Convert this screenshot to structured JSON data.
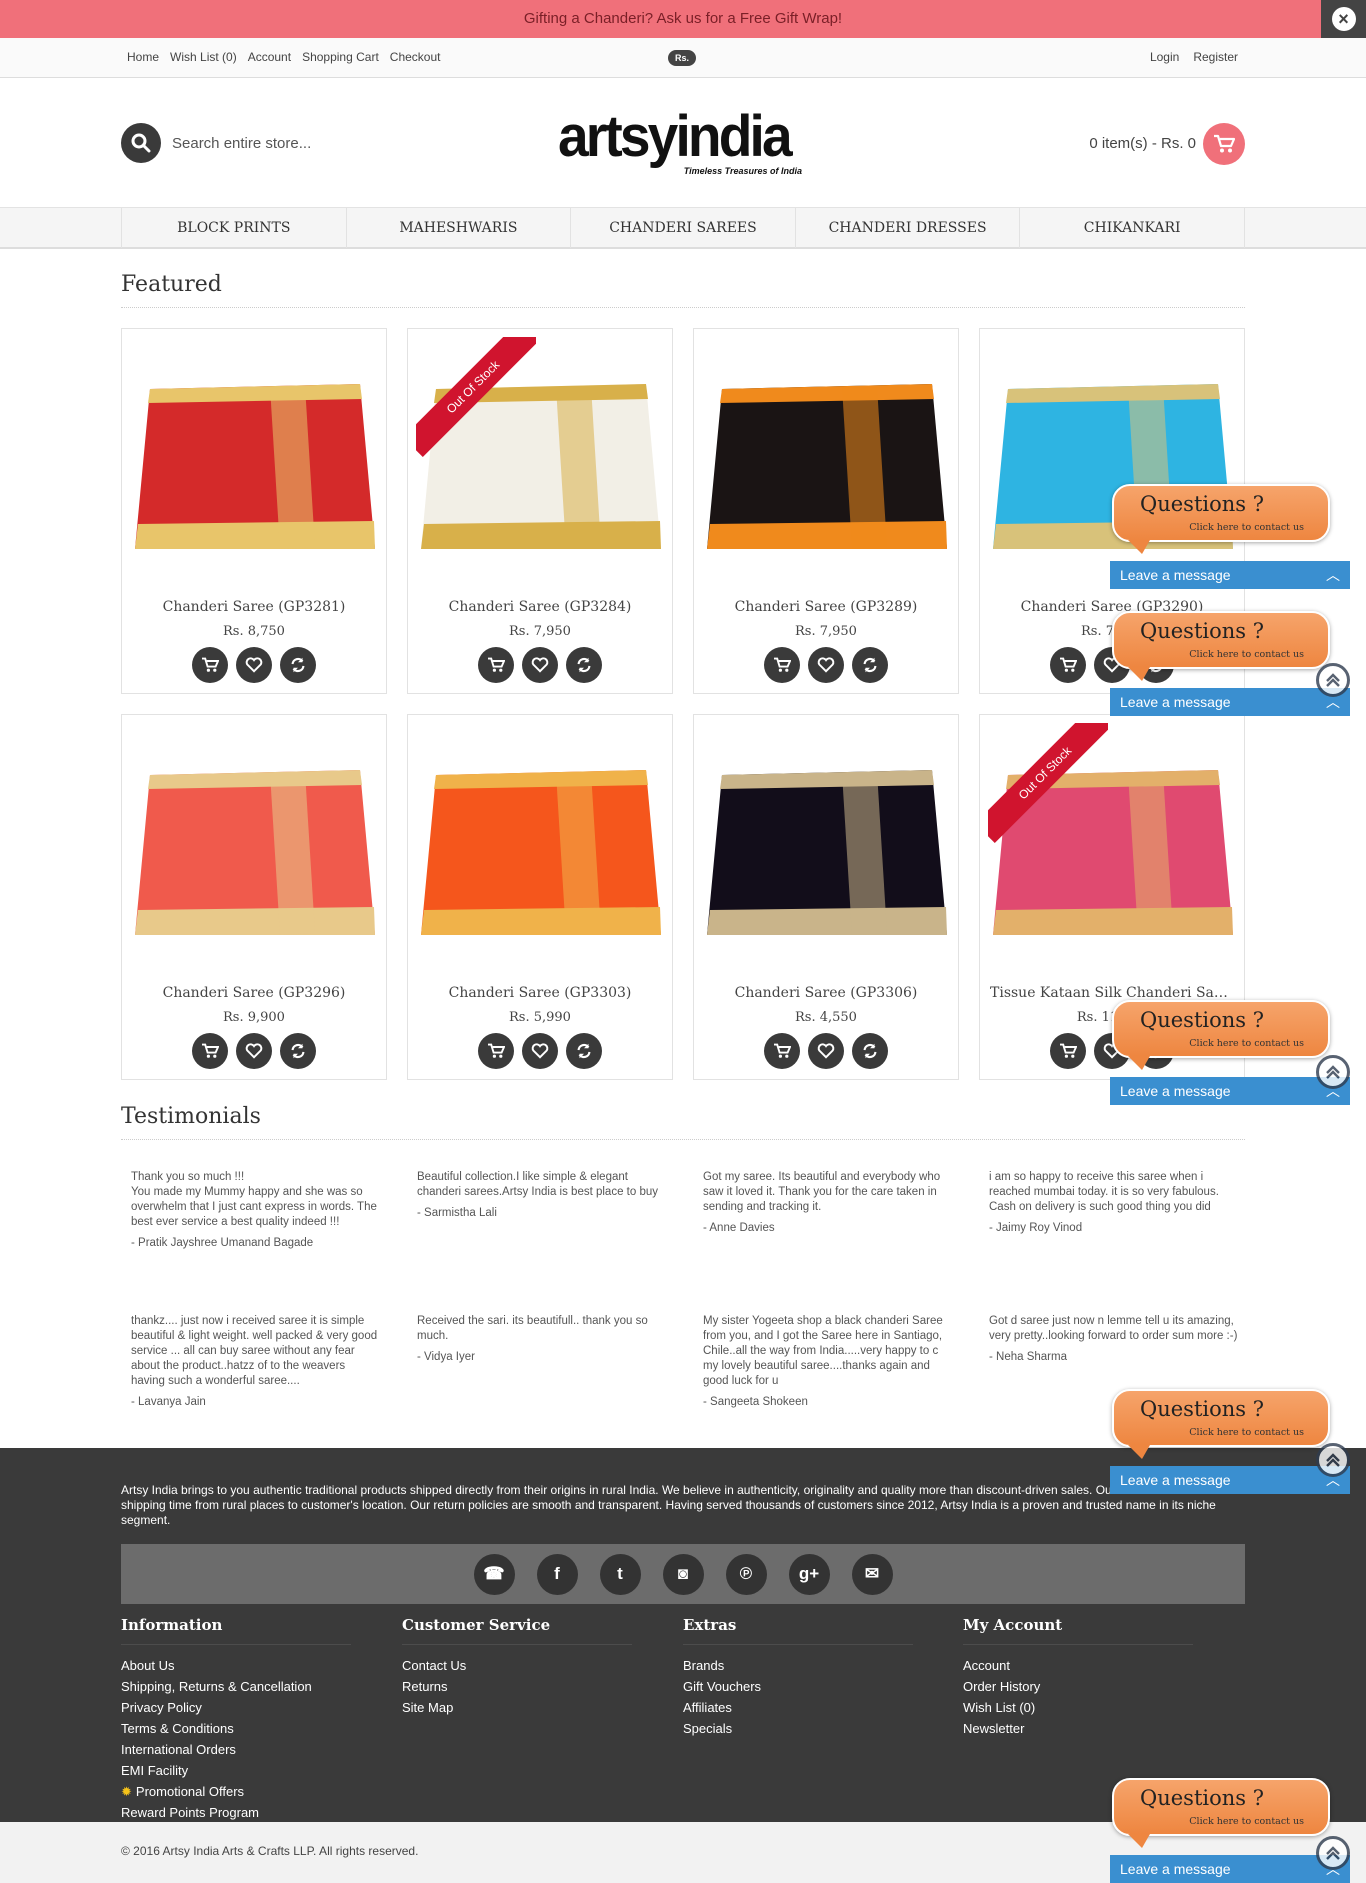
{
  "promo": {
    "text": "Gifting a Chanderi? Ask us for a Free Gift Wrap!",
    "close_icon": "close-icon"
  },
  "toplinks": {
    "left": [
      "Home",
      "Wish List (0)",
      "Account",
      "Shopping Cart",
      "Checkout"
    ],
    "currency": "Rs.",
    "right": [
      "Login",
      "Register"
    ]
  },
  "header": {
    "search_placeholder": "Search entire store...",
    "logo_main": "artsyindia",
    "logo_tagline": "Timeless Treasures of India",
    "cart_text": "0 item(s) - Rs. 0"
  },
  "nav": [
    "BLOCK PRINTS",
    "MAHESHWARIS",
    "CHANDERI SAREES",
    "CHANDERI DRESSES",
    "CHIKANKARI"
  ],
  "featured": {
    "title": "Featured",
    "out_of_stock_label": "Out Of Stock",
    "products": [
      {
        "name": "Chanderi Saree (GP3281)",
        "price": "Rs. 8,750",
        "out_of_stock": false,
        "colors": [
          "#d42a2a",
          "#e8c56a"
        ]
      },
      {
        "name": "Chanderi Saree (GP3284)",
        "price": "Rs. 7,950",
        "out_of_stock": true,
        "colors": [
          "#f2efe6",
          "#d8b04a"
        ]
      },
      {
        "name": "Chanderi Saree (GP3289)",
        "price": "Rs. 7,950",
        "out_of_stock": false,
        "colors": [
          "#1a1414",
          "#f08a1c"
        ]
      },
      {
        "name": "Chanderi Saree (GP3290)",
        "price": "Rs. 7,950",
        "out_of_stock": false,
        "colors": [
          "#2eb4e2",
          "#d8c27a"
        ]
      },
      {
        "name": "Chanderi Saree (GP3296)",
        "price": "Rs. 9,900",
        "out_of_stock": false,
        "colors": [
          "#f05a4c",
          "#e8c98a"
        ]
      },
      {
        "name": "Chanderi Saree (GP3303)",
        "price": "Rs. 5,990",
        "out_of_stock": false,
        "colors": [
          "#f5561c",
          "#f0b24a"
        ]
      },
      {
        "name": "Chanderi Saree (GP3306)",
        "price": "Rs. 4,550",
        "out_of_stock": false,
        "colors": [
          "#120d1a",
          "#c9b48a"
        ]
      },
      {
        "name": "Tissue Kataan Silk Chanderi Saree...",
        "price": "Rs. 11,500",
        "out_of_stock": true,
        "colors": [
          "#e04a70",
          "#e3b06a"
        ]
      }
    ],
    "action_icons": [
      "cart-icon",
      "heart-icon",
      "compare-icon"
    ]
  },
  "testimonials": {
    "title": "Testimonials",
    "items": [
      {
        "text": "Thank you so much !!!\nYou made my Mummy happy and she was so overwhelm that I just cant express in words. The best ever service a best quality indeed !!!",
        "author": "- Pratik Jayshree Umanand Bagade"
      },
      {
        "text": "Beautiful collection.I like simple & elegant chanderi sarees.Artsy India is best place to buy",
        "author": "- Sarmistha Lali"
      },
      {
        "text": "Got my saree. Its beautiful and everybody who saw it loved it. Thank you for the care taken in sending and tracking it.",
        "author": "- Anne Davies"
      },
      {
        "text": "i am so happy to receive this saree when i reached mumbai today. it is so very fabulous. Cash on delivery is such good thing you did",
        "author": "- Jaimy Roy Vinod"
      },
      {
        "text": "thankz.... just now i received saree it is simple beautiful & light weight. well packed & very good service ... all can buy saree without any fear about the product..hatzz of to the weavers having such a wonderful saree....",
        "author": "- Lavanya Jain"
      },
      {
        "text": "Received the sari. its beautifull.. thank you so much.",
        "author": "- Vidya Iyer"
      },
      {
        "text": "My sister Yogeeta shop a black chanderi Saree from you, and I got the Saree here in Santiago, Chile..all the way from India.....very happy to c my lovely beautiful saree....thanks again and good luck for u",
        "author": "- Sangeeta Shokeen"
      },
      {
        "text": "Got d saree just now n lemme tell u its amazing, very pretty..looking forward to order sum more :-)",
        "author": "- Neha Sharma"
      }
    ]
  },
  "footer": {
    "about": "Artsy India brings to you authentic traditional products shipped directly from their origins in rural India. We believe in authenticity, originality and quality more than discount-driven sales. Our endeavour is to reduce shipping time from rural places to customer's location. Our return policies are smooth and transparent. Having served thousands of customers since 2012, Artsy India is a proven and trusted name in its niche segment.",
    "social": [
      {
        "icon": "phone-icon",
        "glyph": "☎"
      },
      {
        "icon": "facebook-icon",
        "glyph": "f"
      },
      {
        "icon": "tumblr-icon",
        "glyph": "t"
      },
      {
        "icon": "instagram-icon",
        "glyph": "◙"
      },
      {
        "icon": "pinterest-icon",
        "glyph": "℗"
      },
      {
        "icon": "google-plus-icon",
        "glyph": "g+"
      },
      {
        "icon": "email-icon",
        "glyph": "✉"
      }
    ],
    "columns": [
      {
        "title": "Information",
        "links": [
          "About Us",
          "Shipping, Returns & Cancellation",
          "Privacy Policy",
          "Terms & Conditions",
          "International Orders",
          "EMI Facility",
          "Promotional Offers",
          "Reward Points Program"
        ]
      },
      {
        "title": "Customer Service",
        "links": [
          "Contact Us",
          "Returns",
          "Site Map"
        ]
      },
      {
        "title": "Extras",
        "links": [
          "Brands",
          "Gift Vouchers",
          "Affiliates",
          "Specials"
        ]
      },
      {
        "title": "My Account",
        "links": [
          "Account",
          "Order History",
          "Wish List (0)",
          "Newsletter"
        ]
      }
    ],
    "copyright": "© 2016 Artsy India Arts & Crafts LLP. All rights reserved."
  },
  "chat": {
    "question": "Questions ?",
    "sub": "Click here to contact us",
    "bar": "Leave a message"
  },
  "colors": {
    "accent": "#f0707a",
    "chat_orange": "#ee8640",
    "chat_blue": "#3a8fd0",
    "footer_bg": "#3a3a3a"
  }
}
